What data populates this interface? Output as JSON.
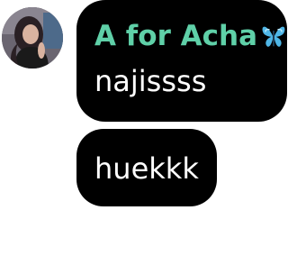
{
  "conversation": {
    "sender": {
      "name": "A for Acha",
      "name_color": "#5fd0a8",
      "badge_icon": "butterfly-icon"
    },
    "messages": [
      {
        "text": "najissss"
      },
      {
        "text": "huekkk"
      }
    ],
    "bubble_color": "#000000",
    "text_color": "#ffffff"
  }
}
